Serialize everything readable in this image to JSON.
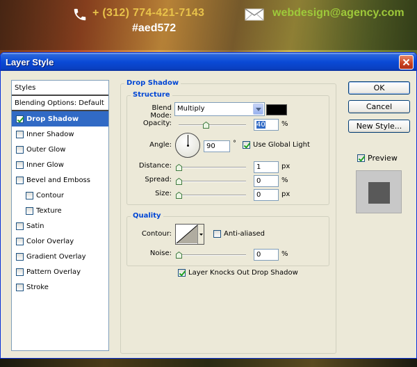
{
  "banner": {
    "phone": "+ (312) 774-421-7143",
    "email": "webdesign@agency.com",
    "hex": "#aed572"
  },
  "window": {
    "title": "Layer Style"
  },
  "styles": {
    "header": "Styles",
    "blending": "Blending Options: Default",
    "items": [
      {
        "label": "Drop Shadow",
        "checked": true,
        "selected": true,
        "sub": false
      },
      {
        "label": "Inner Shadow",
        "checked": false,
        "selected": false,
        "sub": false
      },
      {
        "label": "Outer Glow",
        "checked": false,
        "selected": false,
        "sub": false
      },
      {
        "label": "Inner Glow",
        "checked": false,
        "selected": false,
        "sub": false
      },
      {
        "label": "Bevel and Emboss",
        "checked": false,
        "selected": false,
        "sub": false
      },
      {
        "label": "Contour",
        "checked": false,
        "selected": false,
        "sub": true
      },
      {
        "label": "Texture",
        "checked": false,
        "selected": false,
        "sub": true
      },
      {
        "label": "Satin",
        "checked": false,
        "selected": false,
        "sub": false
      },
      {
        "label": "Color Overlay",
        "checked": false,
        "selected": false,
        "sub": false
      },
      {
        "label": "Gradient Overlay",
        "checked": false,
        "selected": false,
        "sub": false
      },
      {
        "label": "Pattern Overlay",
        "checked": false,
        "selected": false,
        "sub": false
      },
      {
        "label": "Stroke",
        "checked": false,
        "selected": false,
        "sub": false
      }
    ]
  },
  "drop_shadow": {
    "title": "Drop Shadow",
    "structure": {
      "title": "Structure",
      "blend_mode_label": "Blend Mode:",
      "blend_mode": "Multiply",
      "shadow_color": "#000000",
      "opacity_label": "Opacity:",
      "opacity": "40",
      "opacity_unit": "%",
      "opacity_pct": 40,
      "angle_label": "Angle:",
      "angle": "90",
      "angle_unit": "°",
      "global_light_label": "Use Global Light",
      "global_light": true,
      "distance_label": "Distance:",
      "distance": "1",
      "distance_unit": "px",
      "distance_pct": 0,
      "spread_label": "Spread:",
      "spread": "0",
      "spread_unit": "%",
      "spread_pct": 0,
      "size_label": "Size:",
      "size": "0",
      "size_unit": "px",
      "size_pct": 0
    },
    "quality": {
      "title": "Quality",
      "contour_label": "Contour:",
      "anti_aliased_label": "Anti-aliased",
      "anti_aliased": false,
      "noise_label": "Noise:",
      "noise": "0",
      "noise_unit": "%",
      "noise_pct": 0
    },
    "knockout_label": "Layer Knocks Out Drop Shadow",
    "knockout": true
  },
  "buttons": {
    "ok": "OK",
    "cancel": "Cancel",
    "new_style": "New Style...",
    "preview_label": "Preview",
    "preview": true
  }
}
